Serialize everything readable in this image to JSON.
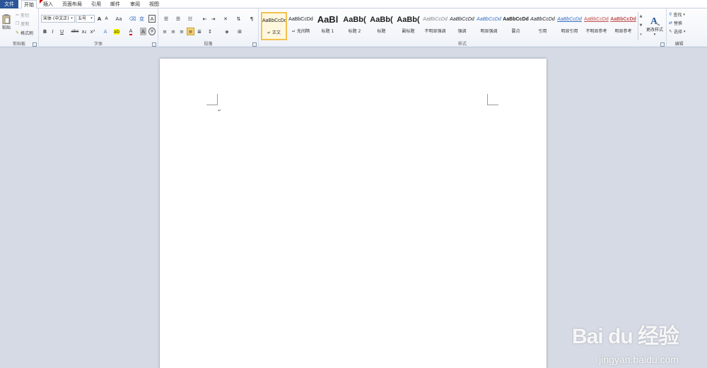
{
  "tabs": [
    {
      "label": "文件"
    },
    {
      "label": "开始"
    },
    {
      "label": "插入"
    },
    {
      "label": "页面布局"
    },
    {
      "label": "引用"
    },
    {
      "label": "邮件"
    },
    {
      "label": "审阅"
    },
    {
      "label": "视图"
    }
  ],
  "clipboard": {
    "paste": "粘贴",
    "cut": "剪切",
    "copy": "复制",
    "format_painter": "格式刷",
    "label": "剪贴板"
  },
  "font": {
    "name": "宋体 (中文正)",
    "size": "五号",
    "label": "字体",
    "grow": "A",
    "shrink": "A",
    "case": "Aa",
    "bold": "B",
    "italic": "I",
    "underline": "U",
    "strike": "abc",
    "sub": "x₂",
    "sup": "x²",
    "color_a": "A"
  },
  "paragraph": {
    "label": "段落"
  },
  "styles": {
    "label": "样式",
    "items": [
      {
        "preview": "AaBbCcDd",
        "name": "↵ 正文"
      },
      {
        "preview": "AaBbCcDd",
        "name": "↵ 无间隔"
      },
      {
        "preview": "AaBl",
        "name": "标题 1"
      },
      {
        "preview": "AaBb(",
        "name": "标题 2"
      },
      {
        "preview": "AaBb(",
        "name": "标题"
      },
      {
        "preview": "AaBb(",
        "name": "副标题"
      },
      {
        "preview": "AaBbCcDd",
        "name": "不明显强调"
      },
      {
        "preview": "AaBbCcDd",
        "name": "强调"
      },
      {
        "preview": "AaBbCcDd",
        "name": "明显强调"
      },
      {
        "preview": "AaBbCcDd",
        "name": "要点"
      },
      {
        "preview": "AaBbCcDd",
        "name": "引用"
      },
      {
        "preview": "AaBbCcDd",
        "name": "明显引用"
      },
      {
        "preview": "AaBbCcDd",
        "name": "不明显参考"
      },
      {
        "preview": "AaBbCcDd",
        "name": "明显参考"
      }
    ],
    "change_styles": "更改样式"
  },
  "editing": {
    "find": "查找",
    "replace": "替换",
    "select": "选择",
    "label": "编辑"
  },
  "document": {
    "paragraph_mark": "↵"
  },
  "watermark": {
    "logo": "Bai du 经验",
    "url": "jingyan.baidu.com"
  },
  "colors": {
    "file_tab": "#2a5699",
    "ribbon_bg": "#eef2f8",
    "doc_bg": "#d5dae5",
    "selected_style": "#f2c24f"
  }
}
